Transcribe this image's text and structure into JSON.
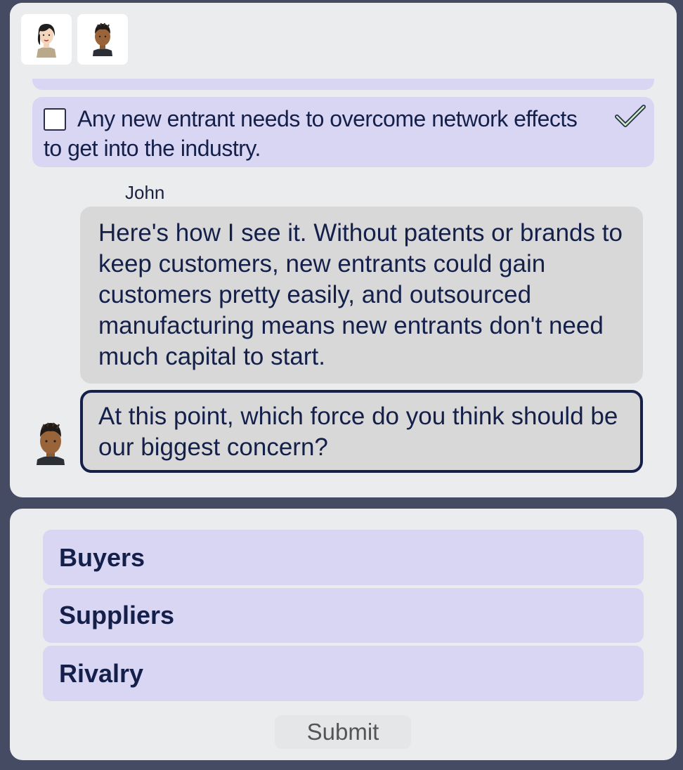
{
  "participants": [
    {
      "icon": "woman-avatar-icon"
    },
    {
      "icon": "man-avatar-icon"
    }
  ],
  "checklist": {
    "item_text": "Any new entrant needs to overcome network effects to get into the industry.",
    "checked_indicator": "checkmark-icon"
  },
  "chat": {
    "speaker": "John",
    "messages": [
      "Here's how I see it. Without patents or brands to keep customers, new entrants could gain customers pretty easily, and outsourced manufacturing means new entrants don't need much capital to start.",
      "At this point, which force do you think should be our biggest concern?"
    ]
  },
  "answers": {
    "options": [
      "Buyers",
      "Suppliers",
      "Rivalry"
    ],
    "submit_label": "Submit"
  },
  "colors": {
    "background": "#454b63",
    "panel": "#ebecee",
    "option": "#d9d6f4",
    "bubble": "#d8d8d8",
    "text": "#14204a"
  }
}
